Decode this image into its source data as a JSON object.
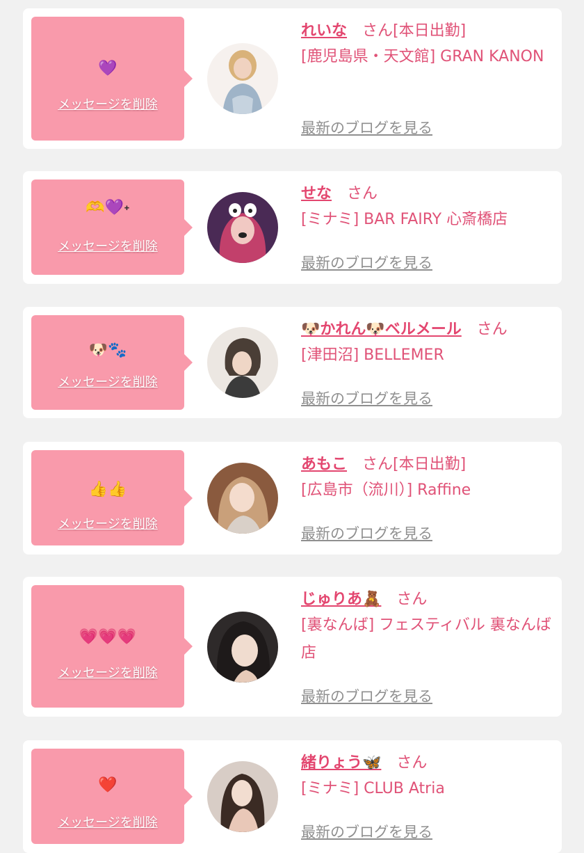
{
  "colors": {
    "page_bg": "#f1f1f1",
    "card_bg": "#ffffff",
    "bubble_bg": "#f99aab",
    "name_pink": "#e3466f",
    "muted_link": "#8f8f8f"
  },
  "labels": {
    "delete_message": "メッセージを削除",
    "view_blog": "最新のブログを見る",
    "honorific": "さん"
  },
  "messages": [
    {
      "emoji": "💜",
      "name": "れいな",
      "status": "[本日出勤]",
      "shop": "[鹿児島県・天文館] GRAN KANON",
      "avatar_icon": "girl-photo-avatar"
    },
    {
      "emoji": "🫶💜˖",
      "name": "せな",
      "status": "",
      "shop": "[ミナミ] BAR FAIRY 心斎橋店",
      "avatar_icon": "girl-photo-avatar"
    },
    {
      "emoji": "🐶🐾",
      "name": "🐶かれん🐶ベルメール",
      "status": "",
      "shop": "[津田沼] BELLEMER",
      "avatar_icon": "girl-photo-avatar"
    },
    {
      "emoji": "👍👍",
      "name": "あもこ",
      "status": "[本日出勤]",
      "shop": "[広島市（流川）] Raffine",
      "avatar_icon": "girl-photo-avatar"
    },
    {
      "emoji": "💗💗💗",
      "name": "じゅりあ🧸",
      "status": "",
      "shop": "[裏なんば] フェスティバル 裏なんば店",
      "avatar_icon": "girl-photo-avatar"
    },
    {
      "emoji": "❤️",
      "name": "緒りょう🦋",
      "status": "",
      "shop": "[ミナミ] CLUB Atria",
      "avatar_icon": "girl-photo-avatar"
    }
  ]
}
